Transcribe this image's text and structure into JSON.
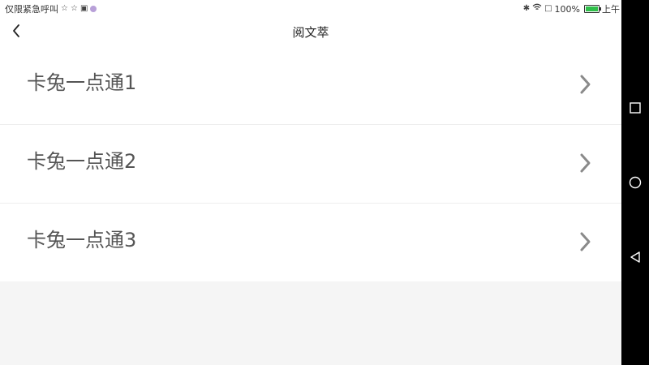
{
  "status_bar": {
    "left_text": "仅限紧急呼叫",
    "battery": "100%",
    "time": "上午",
    "battery_level": 1.0
  },
  "header": {
    "title": "阅文萃"
  },
  "list": {
    "items": [
      {
        "label": "卡兔一点通1"
      },
      {
        "label": "卡兔一点通2"
      },
      {
        "label": "卡兔一点通3"
      }
    ]
  },
  "icons": {
    "back": "chevron-left-icon",
    "row": "chevron-right-icon",
    "nav_recent": "square-icon",
    "nav_home": "circle-icon",
    "nav_back": "triangle-icon"
  },
  "colors": {
    "battery": "#2fbf4a",
    "label": "#555555",
    "chevron": "#8a8a8a"
  }
}
